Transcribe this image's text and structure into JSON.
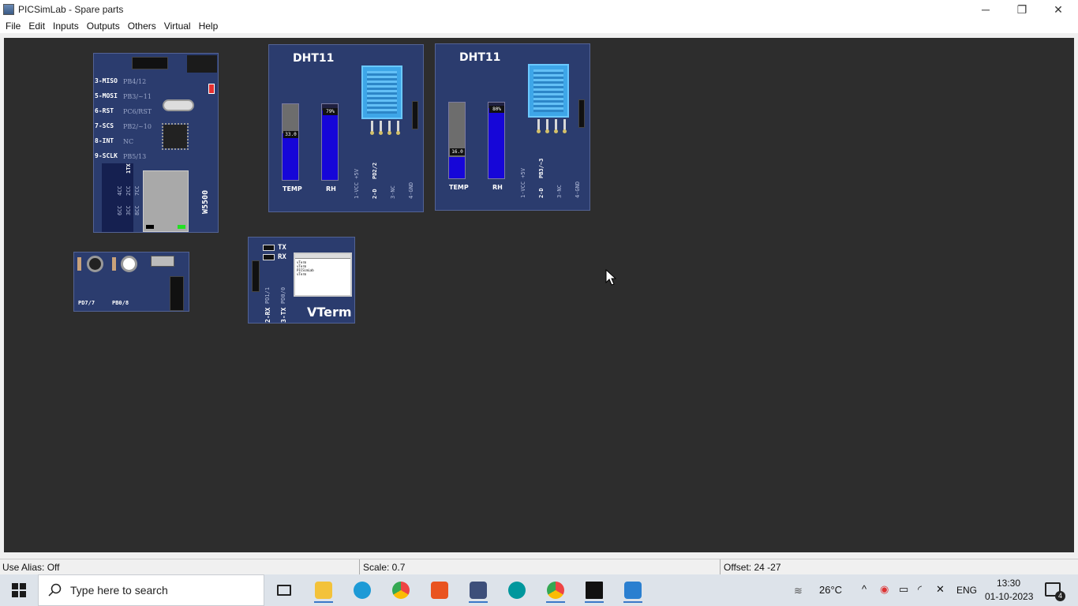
{
  "window": {
    "title": "PICSimLab - Spare parts",
    "controls": {
      "minimize": "─",
      "restore": "❐",
      "close": "✕"
    }
  },
  "menu": [
    "File",
    "Edit",
    "Inputs",
    "Outputs",
    "Others",
    "Virtual",
    "Help"
  ],
  "parts": {
    "w5500": {
      "pins": [
        {
          "label": "3-MISO",
          "sub": "PB4/12"
        },
        {
          "label": "5-MOSI",
          "sub": "PB3/~11"
        },
        {
          "label": "6-RST",
          "sub": "PC6/RST"
        },
        {
          "label": "7-SCS",
          "sub": "PB2/~10"
        },
        {
          "label": "8-INT",
          "sub": "NC"
        },
        {
          "label": "9-SCLK",
          "sub": "PB5/13"
        }
      ],
      "name": "W5500",
      "side_pins": [
        "1TX",
        "2CC",
        "3CC",
        "4CC",
        "6CC",
        "7CC",
        "8CC"
      ]
    },
    "dht11_a": {
      "title": "DHT11",
      "temp_value": "33.0",
      "temp_level": 0.6,
      "rh_value": "79%",
      "rh_level": 0.9,
      "temp_label": "TEMP",
      "rh_label": "RH",
      "pins": [
        "1-VCC +5V",
        "2-D",
        "3-NC",
        "4-GND"
      ],
      "data_pin": "PD2/2",
      "gnd_label": "GND"
    },
    "dht11_b": {
      "title": "DHT11",
      "temp_value": "16.0",
      "temp_level": 0.28,
      "rh_value": "80%",
      "rh_level": 0.91,
      "temp_label": "TEMP",
      "rh_label": "RH",
      "pins": [
        "1-VCC +5V",
        "2-D",
        "3-NC",
        "4-GND"
      ],
      "data_pin": "PB3/~3",
      "gnd_label": "GND"
    },
    "buttons": {
      "labels": [
        "PD7/7",
        "PB0/8"
      ]
    },
    "vterm": {
      "tx": "TX",
      "rx": "RX",
      "rx_pin": "2-RX",
      "rx_pin_sub": "PD1/1",
      "tx_pin": "3-TX",
      "tx_pin_sub": "PD0/0",
      "name": "VTerm",
      "screen_lines": [
        "vTerm",
        "vTerm",
        "PICSimLab",
        "vTerm"
      ]
    }
  },
  "status": {
    "alias": "Use Alias: Off",
    "scale": "Scale: 0.7",
    "offset": "Offset:  24 -27"
  },
  "taskbar": {
    "search_placeholder": "Type here to search",
    "weather": "26°C",
    "language": "ENG",
    "time": "13:30",
    "date": "01-10-2023",
    "notifications": "4"
  },
  "colors": {
    "workspace": "#2d2d2d",
    "board": "#2b3c6e",
    "bar_fill": "#1606d8",
    "sensor": "#3ea6e8"
  }
}
